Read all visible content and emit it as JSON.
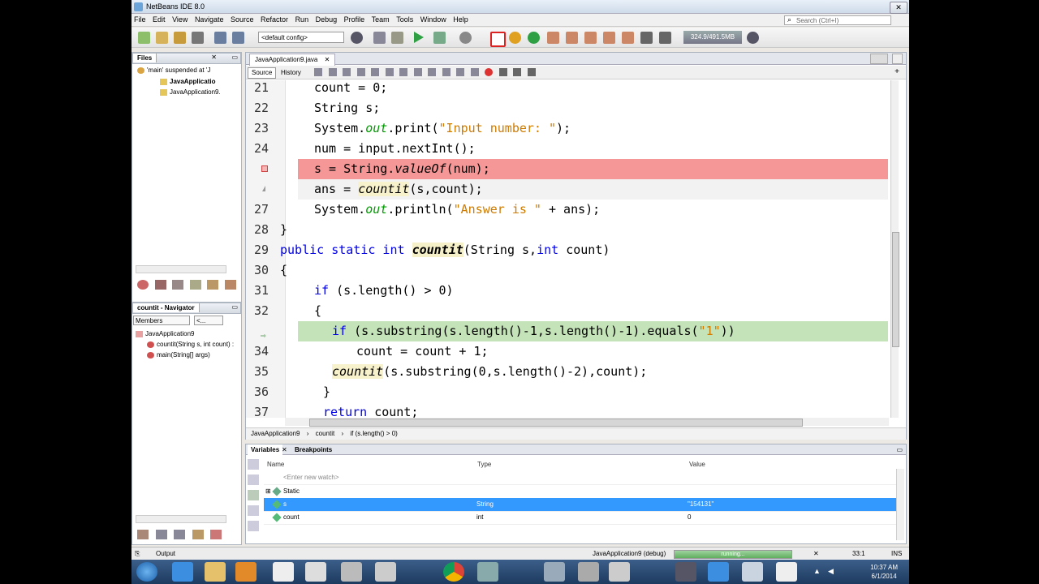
{
  "window": {
    "title": "NetBeans IDE 8.0"
  },
  "menu": [
    "File",
    "Edit",
    "View",
    "Navigate",
    "Source",
    "Refactor",
    "Run",
    "Debug",
    "Profile",
    "Team",
    "Tools",
    "Window",
    "Help"
  ],
  "search": {
    "placeholder": "Search (Ctrl+I)"
  },
  "toolbar": {
    "config": "<default config>",
    "memory": "324.9/491.5MB"
  },
  "files_panel": {
    "tab": "Files",
    "items": [
      "'main' suspended at 'J",
      "JavaApplicatio",
      "JavaApplication9."
    ]
  },
  "navigator": {
    "tab": "countit - Navigator",
    "filter": "Members",
    "filter2": "<...",
    "items": [
      "JavaApplication9",
      "countit(String s, int count) :",
      "main(String[] args)"
    ]
  },
  "editor": {
    "tab": "JavaApplication9.java",
    "source_label": "Source",
    "history_label": "History",
    "lines": [
      {
        "n": "21",
        "t": "count = 0;"
      },
      {
        "n": "22",
        "t": "String s;"
      },
      {
        "n": "23",
        "t": "System.out.print(\"Input number: \");"
      },
      {
        "n": "24",
        "t": "num = input.nextInt();"
      },
      {
        "n": "",
        "t": "s = String.valueOf(num);"
      },
      {
        "n": "",
        "t": "ans = countit(s,count);"
      },
      {
        "n": "27",
        "t": "System.out.println(\"Answer is \" + ans);"
      },
      {
        "n": "28",
        "t": "}"
      },
      {
        "n": "29",
        "t": "public static int countit(String s,int count)"
      },
      {
        "n": "30",
        "t": "{"
      },
      {
        "n": "31",
        "t": "if (s.length() > 0)"
      },
      {
        "n": "32",
        "t": "{"
      },
      {
        "n": "",
        "t": "if (s.substring(s.length()-1,s.length()-1).equals(\"1\"))"
      },
      {
        "n": "34",
        "t": "count = count + 1;"
      },
      {
        "n": "35",
        "t": "countit(s.substring(0,s.length()-2),count);"
      },
      {
        "n": "36",
        "t": "}"
      },
      {
        "n": "37",
        "t": "return count;"
      }
    ],
    "breadcrumbs": [
      "JavaApplication9",
      "countit",
      "if (s.length() > 0)"
    ]
  },
  "variables": {
    "tabs": [
      "Variables",
      "Breakpoints"
    ],
    "headers": [
      "Name",
      "Type",
      "Value"
    ],
    "watch_placeholder": "<Enter new watch>",
    "rows": [
      {
        "name": "Static",
        "type": "",
        "value": ""
      },
      {
        "name": "s",
        "type": "String",
        "value": "\"154131\""
      },
      {
        "name": "count",
        "type": "int",
        "value": "0"
      }
    ]
  },
  "status": {
    "output": "Output",
    "session": "JavaApplication9 (debug)",
    "progress": "running...",
    "position": "33:1",
    "mode": "INS"
  },
  "taskbar": {
    "time": "10:37 AM",
    "date": "6/1/2014"
  },
  "colors": {
    "breakpoint": "#f59797",
    "current_line": "#c4e3b8",
    "keyword": "#0000e6",
    "string": "#ce7b00",
    "selection": "#3399ff"
  }
}
